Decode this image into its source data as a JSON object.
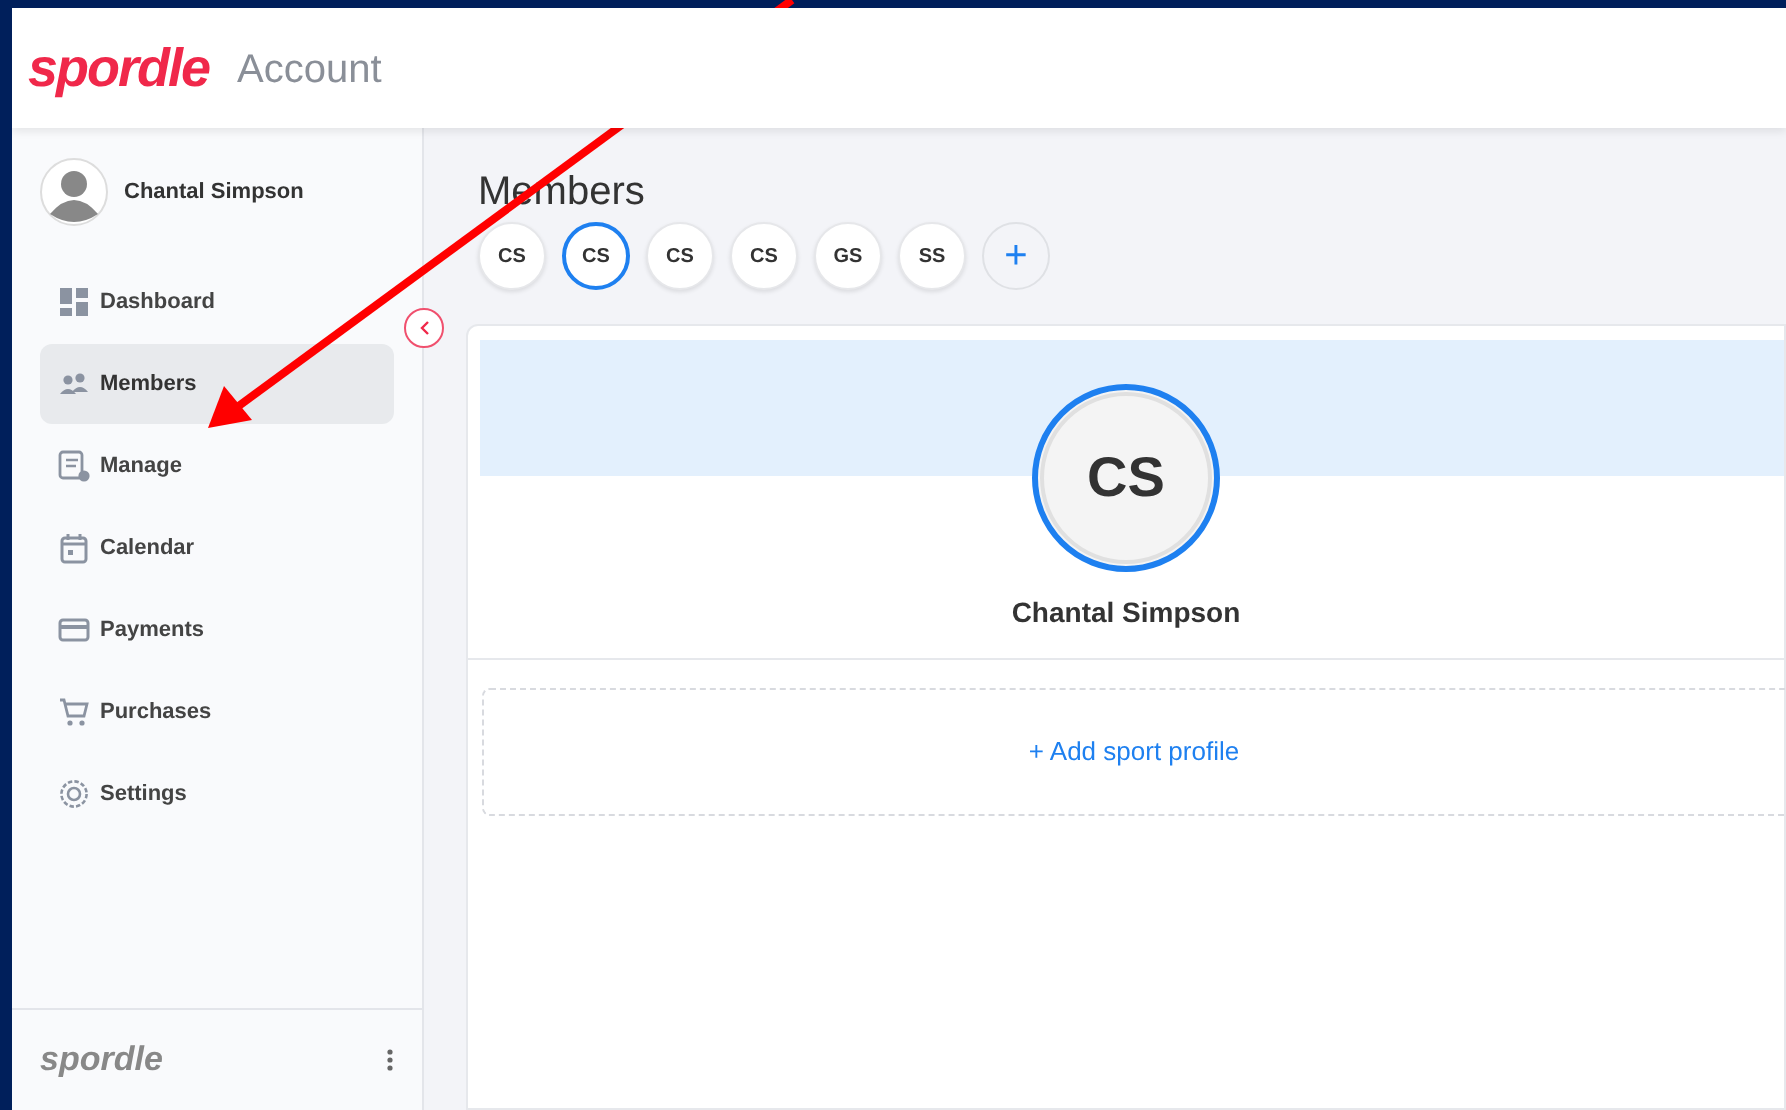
{
  "header": {
    "logo": "spordle",
    "title": "Account"
  },
  "sidebar": {
    "user": {
      "name": "Chantal Simpson"
    },
    "items": [
      {
        "label": "Dashboard",
        "kind": "dashboard",
        "selected": false
      },
      {
        "label": "Members",
        "kind": "members",
        "selected": true
      },
      {
        "label": "Manage",
        "kind": "manage",
        "selected": false
      },
      {
        "label": "Calendar",
        "kind": "calendar",
        "selected": false
      },
      {
        "label": "Payments",
        "kind": "payments",
        "selected": false
      },
      {
        "label": "Purchases",
        "kind": "purchases",
        "selected": false
      },
      {
        "label": "Settings",
        "kind": "settings",
        "selected": false
      }
    ],
    "footer_logo": "spordle"
  },
  "main": {
    "title": "Members",
    "members": [
      {
        "initials": "CS",
        "selected": false
      },
      {
        "initials": "CS",
        "selected": true
      },
      {
        "initials": "CS",
        "selected": false
      },
      {
        "initials": "CS",
        "selected": false
      },
      {
        "initials": "GS",
        "selected": false
      },
      {
        "initials": "SS",
        "selected": false
      }
    ],
    "add_member": "+",
    "profile": {
      "initials": "CS",
      "name": "Chantal Simpson"
    },
    "add_sport_profile": "+ Add sport profile"
  }
}
